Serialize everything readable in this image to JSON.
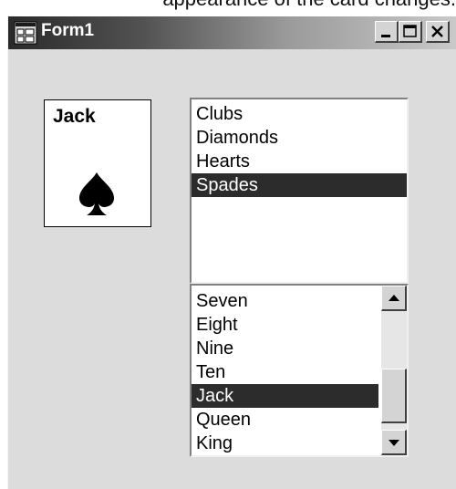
{
  "caption": "appearance of the card changes.",
  "window": {
    "title": "Form1",
    "controls": [
      "minimize-icon",
      "maximize-icon",
      "close-icon"
    ]
  },
  "card": {
    "rank": "Jack",
    "suit_icon": "spade-icon"
  },
  "suit_list": {
    "items": [
      "Clubs",
      "Diamonds",
      "Hearts",
      "Spades"
    ],
    "selected": "Spades"
  },
  "rank_list": {
    "items": [
      "Seven",
      "Eight",
      "Nine",
      "Ten",
      "Jack",
      "Queen",
      "King"
    ],
    "selected": "Jack"
  },
  "colors": {
    "selection_bg": "#2c2c2c",
    "form_bg": "#dcdcdc"
  }
}
